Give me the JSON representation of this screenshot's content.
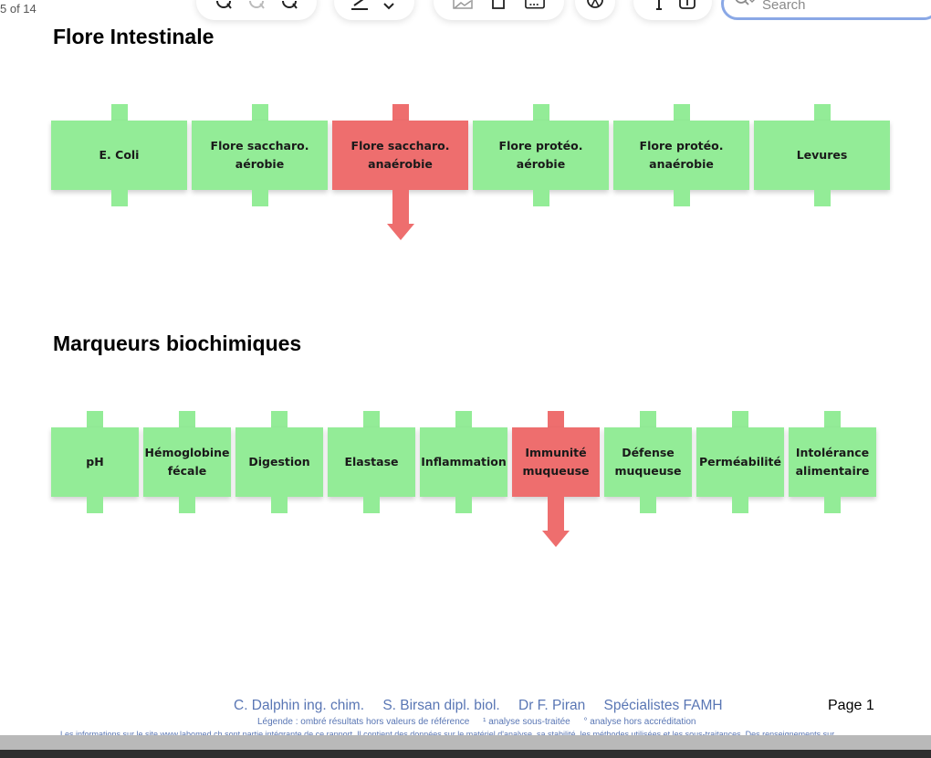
{
  "viewer": {
    "page_indicator": "5 of 14",
    "search_placeholder": "Search"
  },
  "report": {
    "sections": [
      {
        "title": "Flore Intestinale",
        "tiles": [
          {
            "label": "E. Coli",
            "status": "normal"
          },
          {
            "label": "Flore saccharo. aérobie",
            "status": "normal"
          },
          {
            "label": "Flore saccharo. anaérobie",
            "status": "low"
          },
          {
            "label": "Flore protéo. aérobie",
            "status": "normal"
          },
          {
            "label": "Flore protéo. anaérobie",
            "status": "normal"
          },
          {
            "label": "Levures",
            "status": "normal"
          }
        ]
      },
      {
        "title": "Marqueurs biochimiques",
        "tiles": [
          {
            "label": "pH",
            "status": "normal"
          },
          {
            "label": "Hémoglobine fécale",
            "status": "normal"
          },
          {
            "label": "Digestion",
            "status": "normal"
          },
          {
            "label": "Elastase",
            "status": "normal"
          },
          {
            "label": "Inflammation",
            "status": "normal"
          },
          {
            "label": "Immunité muqueuse",
            "status": "low"
          },
          {
            "label": "Défense muqueuse",
            "status": "normal"
          },
          {
            "label": "Perméabilité",
            "status": "normal"
          },
          {
            "label": "Intolérance alimentaire",
            "status": "normal"
          }
        ]
      }
    ],
    "colors": {
      "normal": "#93ec97",
      "alert": "#ee6e6e"
    }
  },
  "footer": {
    "signatures": [
      "C. Dalphin ing. chim.",
      "S. Birsan dipl. biol.",
      "Dr F. Piran",
      "Spécialistes FAMH"
    ],
    "page": "Page 1",
    "legend": [
      "Légende : ombré résultats hors valeurs de référence",
      "¹ analyse sous-traitée",
      "° analyse hors accréditation"
    ],
    "disclaimer": "Les informations sur le site www.labomed.ch sont partie intégrante de ce rapport. Il contient des données sur le matériel d'analyse, sa stabilité, les méthodes utilisées et les sous-traitances. Des renseignements sur"
  }
}
